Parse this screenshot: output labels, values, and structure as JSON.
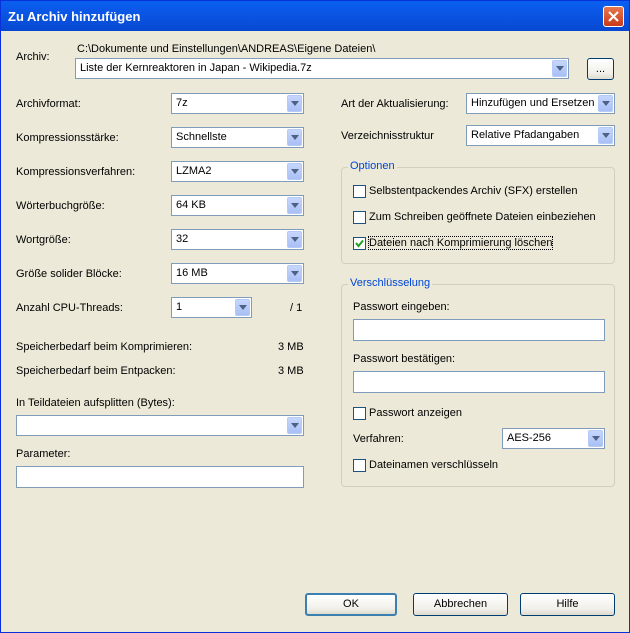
{
  "window": {
    "title": "Zu Archiv hinzufügen"
  },
  "archive": {
    "label": "Archiv:",
    "path": "C:\\Dokumente und Einstellungen\\ANDREAS\\Eigene Dateien\\",
    "filename": "Liste der Kernreaktoren in Japan - Wikipedia.7z",
    "browse_label": "..."
  },
  "left": {
    "format_label": "Archivformat:",
    "format_value": "7z",
    "level_label": "Kompressionsstärke:",
    "level_value": "Schnellste",
    "method_label": "Kompressionsverfahren:",
    "method_value": "LZMA2",
    "dict_label": "Wörterbuchgröße:",
    "dict_value": "64 KB",
    "word_label": "Wortgröße:",
    "word_value": "32",
    "solid_label": "Größe solider Blöcke:",
    "solid_value": "16 MB",
    "threads_label": "Anzahl CPU-Threads:",
    "threads_value": "1",
    "threads_max": "/ 1",
    "mem_comp_label": "Speicherbedarf beim Komprimieren:",
    "mem_comp_value": "3 MB",
    "mem_decomp_label": "Speicherbedarf beim Entpacken:",
    "mem_decomp_value": "3 MB",
    "split_label": "In Teildateien aufsplitten (Bytes):",
    "split_value": "",
    "params_label": "Parameter:",
    "params_value": ""
  },
  "right": {
    "update_label": "Art der Aktualisierung:",
    "update_value": "Hinzufügen und Ersetzen",
    "path_label": "Verzeichnisstruktur",
    "path_value": "Relative Pfadangaben",
    "options_legend": "Optionen",
    "opt_sfx": "Selbstentpackendes Archiv (SFX) erstellen",
    "opt_sfx_checked": false,
    "opt_open": "Zum Schreiben geöffnete Dateien einbeziehen",
    "opt_open_checked": false,
    "opt_delete": "Dateien nach Komprimierung löschen",
    "opt_delete_checked": true,
    "enc_legend": "Verschlüsselung",
    "pw_label": "Passwort eingeben:",
    "pw_value": "",
    "pw2_label": "Passwort bestätigen:",
    "pw2_value": "",
    "show_pw": "Passwort anzeigen",
    "show_pw_checked": false,
    "method_label": "Verfahren:",
    "method_value": "AES-256",
    "enc_names": "Dateinamen verschlüsseln",
    "enc_names_checked": false
  },
  "buttons": {
    "ok": "OK",
    "cancel": "Abbrechen",
    "help": "Hilfe"
  }
}
